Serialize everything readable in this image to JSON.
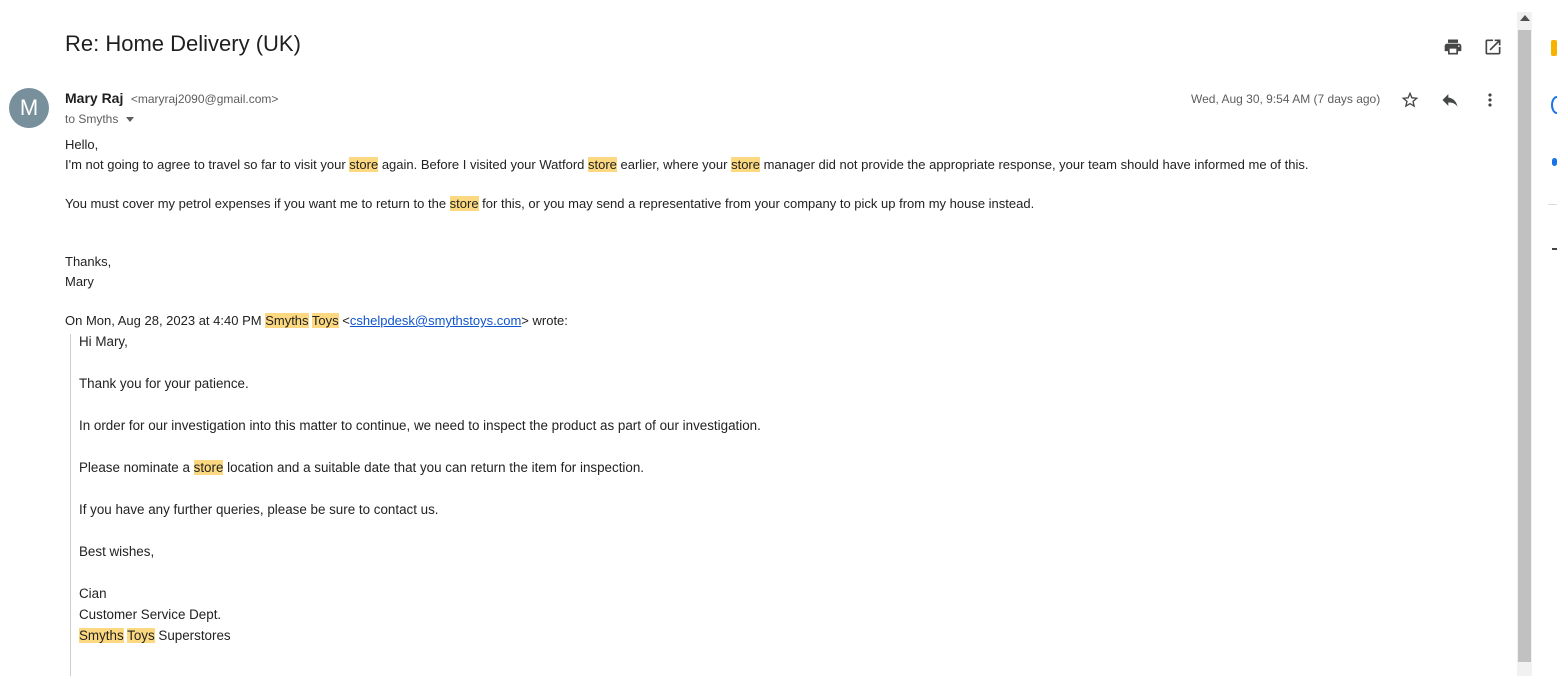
{
  "subject": "Re: Home Delivery (UK)",
  "toolbar": {
    "print_icon": "print-icon",
    "open_new_window_icon": "open-in-new-icon"
  },
  "sender": {
    "avatar_letter": "M",
    "name": "Mary Raj",
    "email": "<maryraj2090@gmail.com>",
    "to_label": "to Smyths",
    "date": "Wed, Aug 30, 9:54 AM (7 days ago)"
  },
  "body": {
    "greeting": "Hello,",
    "p1": {
      "a": "I'm not going to agree to travel so far to visit your ",
      "hl1": "store",
      "b": " again. Before I visited your Watford ",
      "hl2": "store",
      "c": " earlier, where your ",
      "hl3": "store",
      "d": " manager did not provide the appropriate response, your team should have informed me of this."
    },
    "p2": {
      "a": "You must cover my petrol expenses if you want me to return to the ",
      "hl": "store",
      "b": " for this, or you may send a representative from your company to pick up from my house instead."
    },
    "thanks": "Thanks,",
    "sign": "Mary"
  },
  "quote_header": {
    "a": "On Mon, Aug 28, 2023 at 4:40 PM ",
    "hl1": "Smyths",
    "hl2": "Toys",
    "b": " <",
    "link": "cshelpdesk@smythstoys.com",
    "c": "> wrote:"
  },
  "quote": {
    "greeting": "Hi Mary,",
    "l1": "Thank you for your patience.",
    "l2": "In order for our investigation into this matter to continue, we need to inspect the product as part of our investigation.",
    "l3a": "Please nominate a ",
    "l3hl": "store",
    "l3b": " location and a suitable date that you can return the item for inspection.",
    "l4": "If you have any further queries, please be sure to contact us.",
    "l5": "Best wishes,",
    "sig_name": "Cian",
    "sig_dept": "Customer Service Dept.",
    "sig_co_hl1": "Smyths",
    "sig_co_hl2": "Toys",
    "sig_co_rest": " Superstores"
  },
  "colors": {
    "highlight": "#fcd980",
    "avatar": "#78909c",
    "link": "#1155cc"
  }
}
